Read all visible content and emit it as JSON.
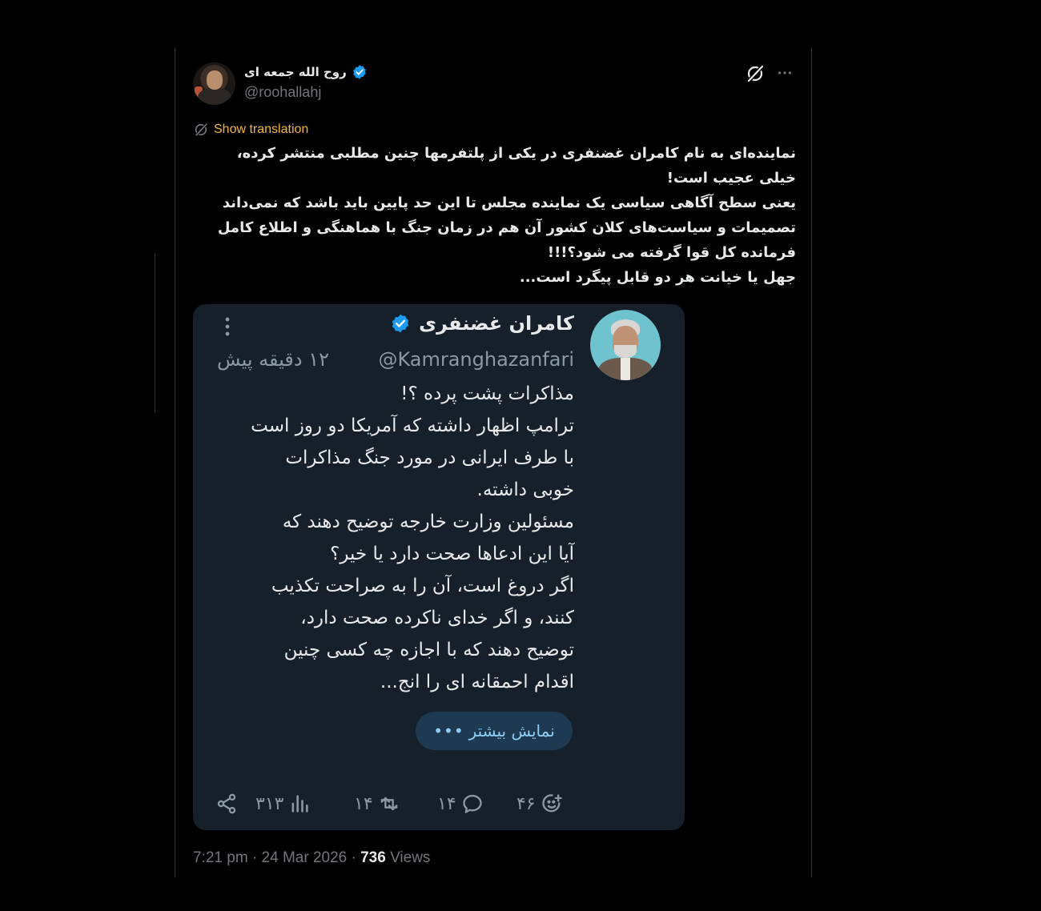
{
  "post": {
    "author_name": "روح الله جمعه ای",
    "author_handle": "@roohallahj",
    "translate_label": "Show translation",
    "text_lines": [
      "نماینده‌ای به نام کامران غضنفری در یکی از پلتفرمها چنین مطلبی منتشر کرده،",
      "خیلی عجیب است!",
      "یعنی سطح آگاهی سیاسی یک نماینده مجلس تا این حد پایین باید باشد که نمی‌داند",
      "تصمیمات و سیاست‌های کلان کشور آن هم در زمان جنگ با هماهنگی و اطلاع کامل",
      "فرمانده کل قوا گرفته می شود؟!!!",
      "جهل یا خیانت هر دو قابل پیگرد است..."
    ],
    "time": "7:21 pm · 24 Mar 2026 · ",
    "views_count": "736",
    "views_label": " Views"
  },
  "quoted": {
    "name": "کامران غضنفری",
    "handle": "@Kamranghazanfari",
    "time": "۱۲ دقیقه پیش",
    "text_lines": [
      "مذاکرات پشت پرده ؟!",
      "ترامپ اظهار داشته که آمریکا دو روز است",
      "با طرف ایرانی در مورد جنگ مذاکرات",
      "خوبی داشته.",
      "مسئولین وزارت خارجه توضیح دهند که",
      "آیا این ادعاها صحت دارد یا خیر؟",
      "اگر دروغ است، آن را به صراحت تکذیب",
      "کنند، و اگر خدای ناکرده صحت دارد،",
      "توضیح دهند که با اجازه چه کسی چنین",
      "اقدام احمقانه ای را انج..."
    ],
    "show_more_label": "نمایش بیشتر",
    "show_more_dots": "•••",
    "stats": {
      "views": "۳۱۳",
      "reposts": "۱۴",
      "replies": "۱۴",
      "reactions": "۴۶"
    }
  },
  "icons": {
    "verified": "verified-badge-icon",
    "grok": "grok-icon",
    "more": "more-options-icon",
    "translate": "translate-icon",
    "share": "share-icon",
    "views": "bar-chart-icon",
    "repost": "repost-icon",
    "reply": "reply-icon",
    "react": "add-reaction-icon"
  },
  "colors": {
    "background": "#000000",
    "card": "#15202b",
    "translate": "#f4b63a",
    "verified": "#1d9bf0",
    "muted": "#71767b"
  }
}
